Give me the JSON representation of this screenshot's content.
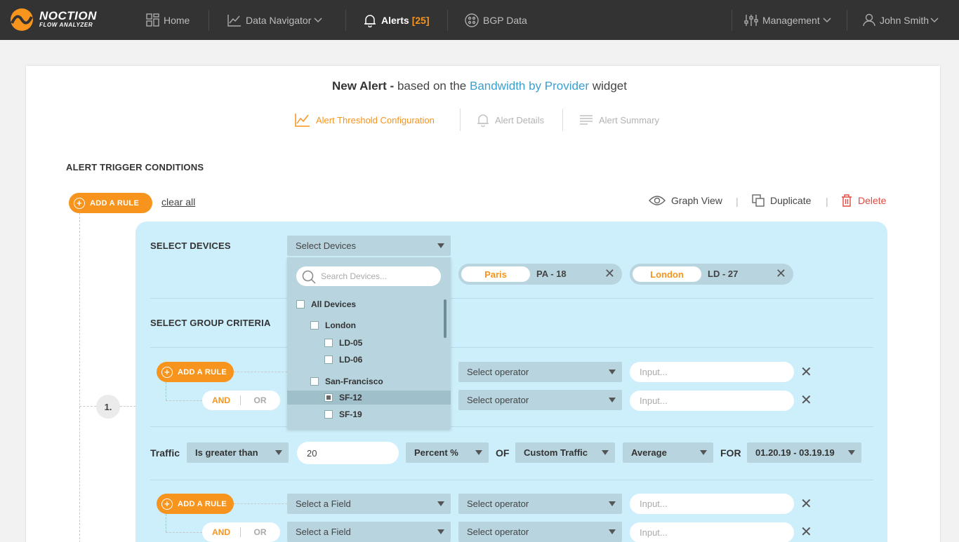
{
  "nav": {
    "logo_line1": "NOCTION",
    "logo_line2": "FLOW ANALYZER",
    "home": "Home",
    "data_navigator": "Data Navigator",
    "alerts": "Alerts",
    "alerts_count": "[25]",
    "bgp_data": "BGP Data",
    "management": "Management",
    "user": "John Smith"
  },
  "title": {
    "bold": "New Alert -",
    "pre": "based on the",
    "link": "Bandwidth by Provider",
    "post": "widget"
  },
  "steps": [
    "Alert Threshold Configuration",
    "Alert Details",
    "Alert Summary"
  ],
  "section_title": "ALERT TRIGGER CONDITIONS",
  "add_rule": "ADD A RULE",
  "clear_all": "clear all",
  "tools": {
    "graph_view": "Graph View",
    "duplicate": "Duplicate",
    "delete": "Delete",
    "sep": "|"
  },
  "rule_number": "1.",
  "devices": {
    "heading": "SELECT DEVICES",
    "select_placeholder": "Select Devices",
    "search_placeholder": "Search Devices...",
    "tree": [
      {
        "label": "All Devices",
        "checked": false
      },
      {
        "label": "London",
        "checked": false
      },
      {
        "label": "LD-05",
        "checked": false
      },
      {
        "label": "LD-06",
        "checked": false
      },
      {
        "label": "San-Francisco",
        "checked": false
      },
      {
        "label": "SF-12",
        "checked": true
      },
      {
        "label": "SF-19",
        "checked": false
      }
    ],
    "chips": [
      {
        "city": "Paris",
        "device": "PA - 18"
      },
      {
        "city": "London",
        "device": "LD - 27"
      }
    ]
  },
  "group": {
    "heading": "SELECT GROUP CRITERIA",
    "operator_placeholder": "Select operator",
    "input_placeholder": "Input...",
    "field_placeholder": "Select a Field",
    "and": "AND",
    "or": "OR"
  },
  "traffic": {
    "label": "Traffic",
    "condition": "Is greater than",
    "value": "20",
    "unit": "Percent %",
    "of": "OF",
    "traffic_type": "Custom Traffic",
    "aggregation": "Average",
    "for": "FOR",
    "range": "01.20.19 - 03.19.19"
  },
  "colors": {
    "accent": "#f7941d",
    "panel": "#cdeefb",
    "link": "#3b9fce",
    "danger": "#e04a3f"
  }
}
